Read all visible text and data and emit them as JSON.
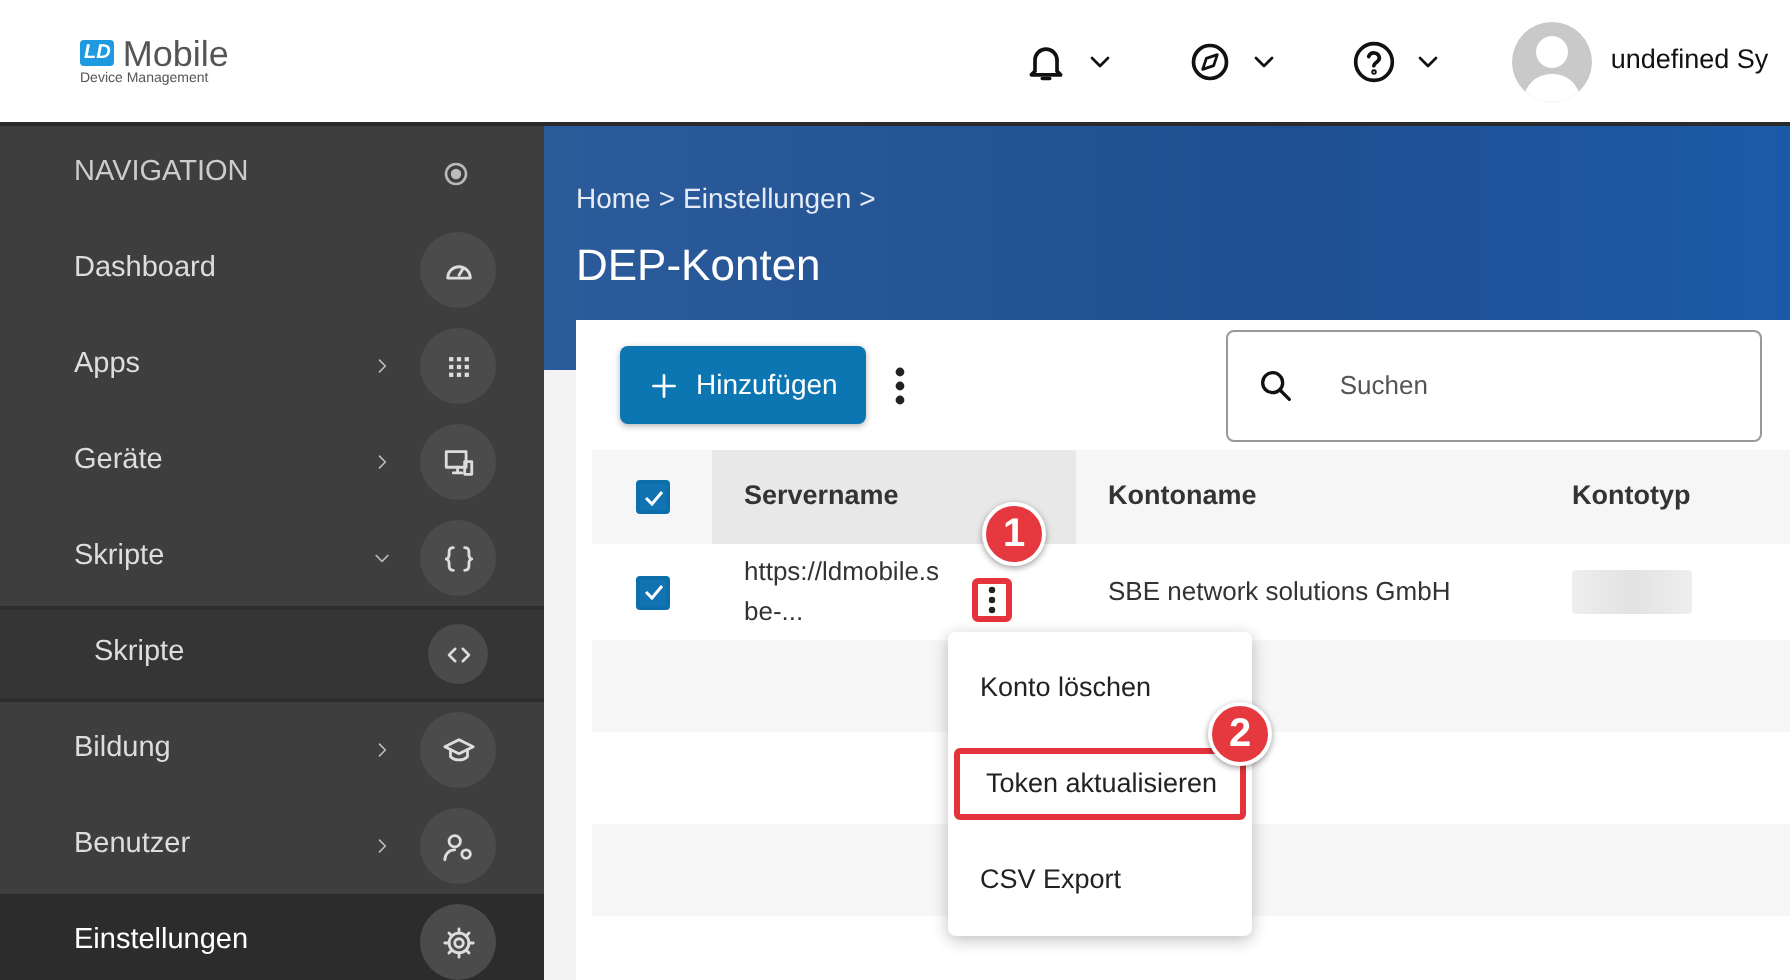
{
  "header": {
    "logo": {
      "mark": "LD",
      "name": "Mobile",
      "tagline": "Device Management"
    },
    "user": {
      "name": "undefined Sy"
    }
  },
  "navigation": {
    "heading": "NAVIGATION",
    "items": [
      {
        "label": "Dashboard",
        "selected": false
      },
      {
        "label": "Apps",
        "selected": false,
        "expanded": false
      },
      {
        "label": "Geräte",
        "selected": false,
        "expanded": false
      },
      {
        "label": "Skripte",
        "selected": false,
        "expanded": true,
        "children": [
          {
            "label": "Skripte",
            "selected": false
          }
        ]
      },
      {
        "label": "Bildung",
        "selected": false,
        "expanded": false
      },
      {
        "label": "Benutzer",
        "selected": false,
        "expanded": false
      },
      {
        "label": "Einstellungen",
        "selected": true
      }
    ]
  },
  "breadcrumb": {
    "items": [
      "Home",
      "Einstellungen"
    ],
    "separator": ">"
  },
  "page_title": "DEP-Konten",
  "toolbar": {
    "add_button": "Hinzufügen",
    "search": {
      "placeholder": "Suchen"
    }
  },
  "table": {
    "all_checked": true,
    "columns": [
      {
        "label": "Servername",
        "sorted": true
      },
      {
        "label": "Kontoname",
        "sorted": false
      },
      {
        "label": "Kontotyp",
        "sorted": false
      }
    ],
    "rows": [
      {
        "checked": true,
        "cells": [
          "https://ldmobile.sbe-...",
          "SBE network solutions GmbH"
        ]
      }
    ]
  },
  "row_menu": {
    "items": [
      {
        "label": "Konto löschen",
        "highlighted": false
      },
      {
        "label": "Token aktualisieren",
        "highlighted": true
      },
      {
        "label": "CSV Export",
        "highlighted": false
      }
    ]
  },
  "step_markers": [
    "1",
    "2"
  ]
}
